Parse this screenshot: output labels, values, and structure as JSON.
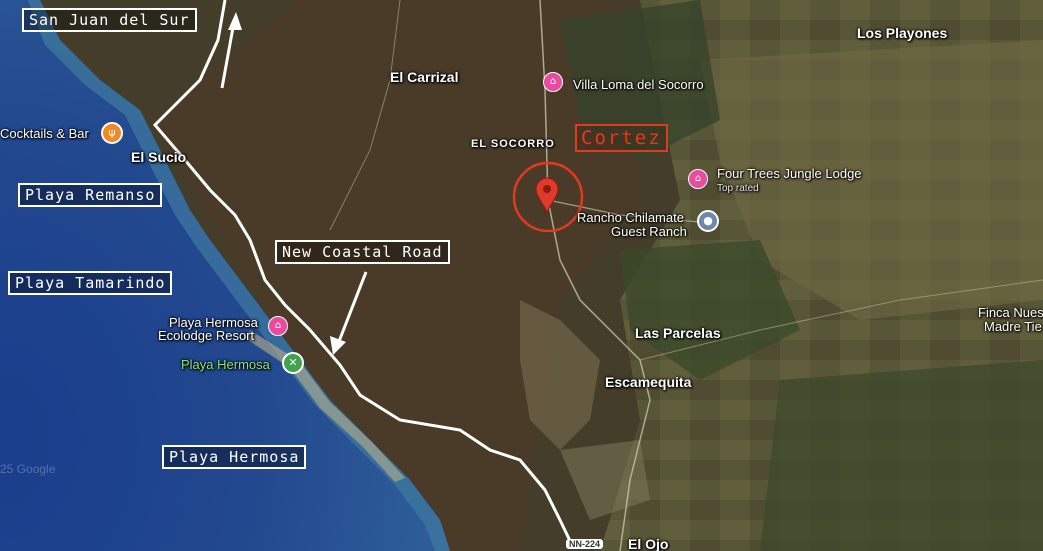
{
  "map": {
    "background_colors": {
      "ocean_deep": "#1f3f86",
      "ocean_shallow": "#2c6fa3",
      "forest_dark": "#3a3826",
      "forest": "#4a4a2e",
      "farmland": "#6b6a44",
      "road": "#ffffff",
      "cortez_red": "#e23a1d",
      "hotel_pink": "#e84c9e",
      "restaurant_orange": "#f08a24",
      "park_green": "#3fa34d"
    },
    "boxed_labels": {
      "san_juan": "San Juan del Sur",
      "remanso": "Playa Remanso",
      "tamarindo": "Playa Tamarindo",
      "coastal_road": "New Coastal Road",
      "hermosa": "Playa Hermosa",
      "cortez": "Cortez"
    },
    "places": {
      "el_carrizal": "El Carrizal",
      "los_playones": "Los Playones",
      "el_socorro": "EL SOCORRO",
      "el_sucio": "El Sucio",
      "las_parcelas": "Las Parcelas",
      "escamequita": "Escamequita",
      "el_ojo": "El Ojo",
      "finca_line1": "Finca Nues",
      "finca_line2": "Madre Tie"
    },
    "pois": {
      "villa_loma": "Villa Loma del Socorro",
      "four_trees": "Four Trees Jungle Lodge",
      "four_trees_sub": "Top rated",
      "rancho_line1": "Rancho Chilamate",
      "rancho_line2": "Guest Ranch",
      "cocktails": "Cocktails & Bar",
      "hermosa_resort_line1": "Playa Hermosa",
      "hermosa_resort_line2": "Ecolodge Resort",
      "playa_hermosa_park": "Playa Hermosa"
    },
    "road_shield": "NN-224",
    "watermark": "25 Google",
    "icons": [
      "hotel-icon",
      "restaurant-icon",
      "park-icon",
      "ranch-icon",
      "location-pin-icon",
      "arrow-icon"
    ]
  }
}
